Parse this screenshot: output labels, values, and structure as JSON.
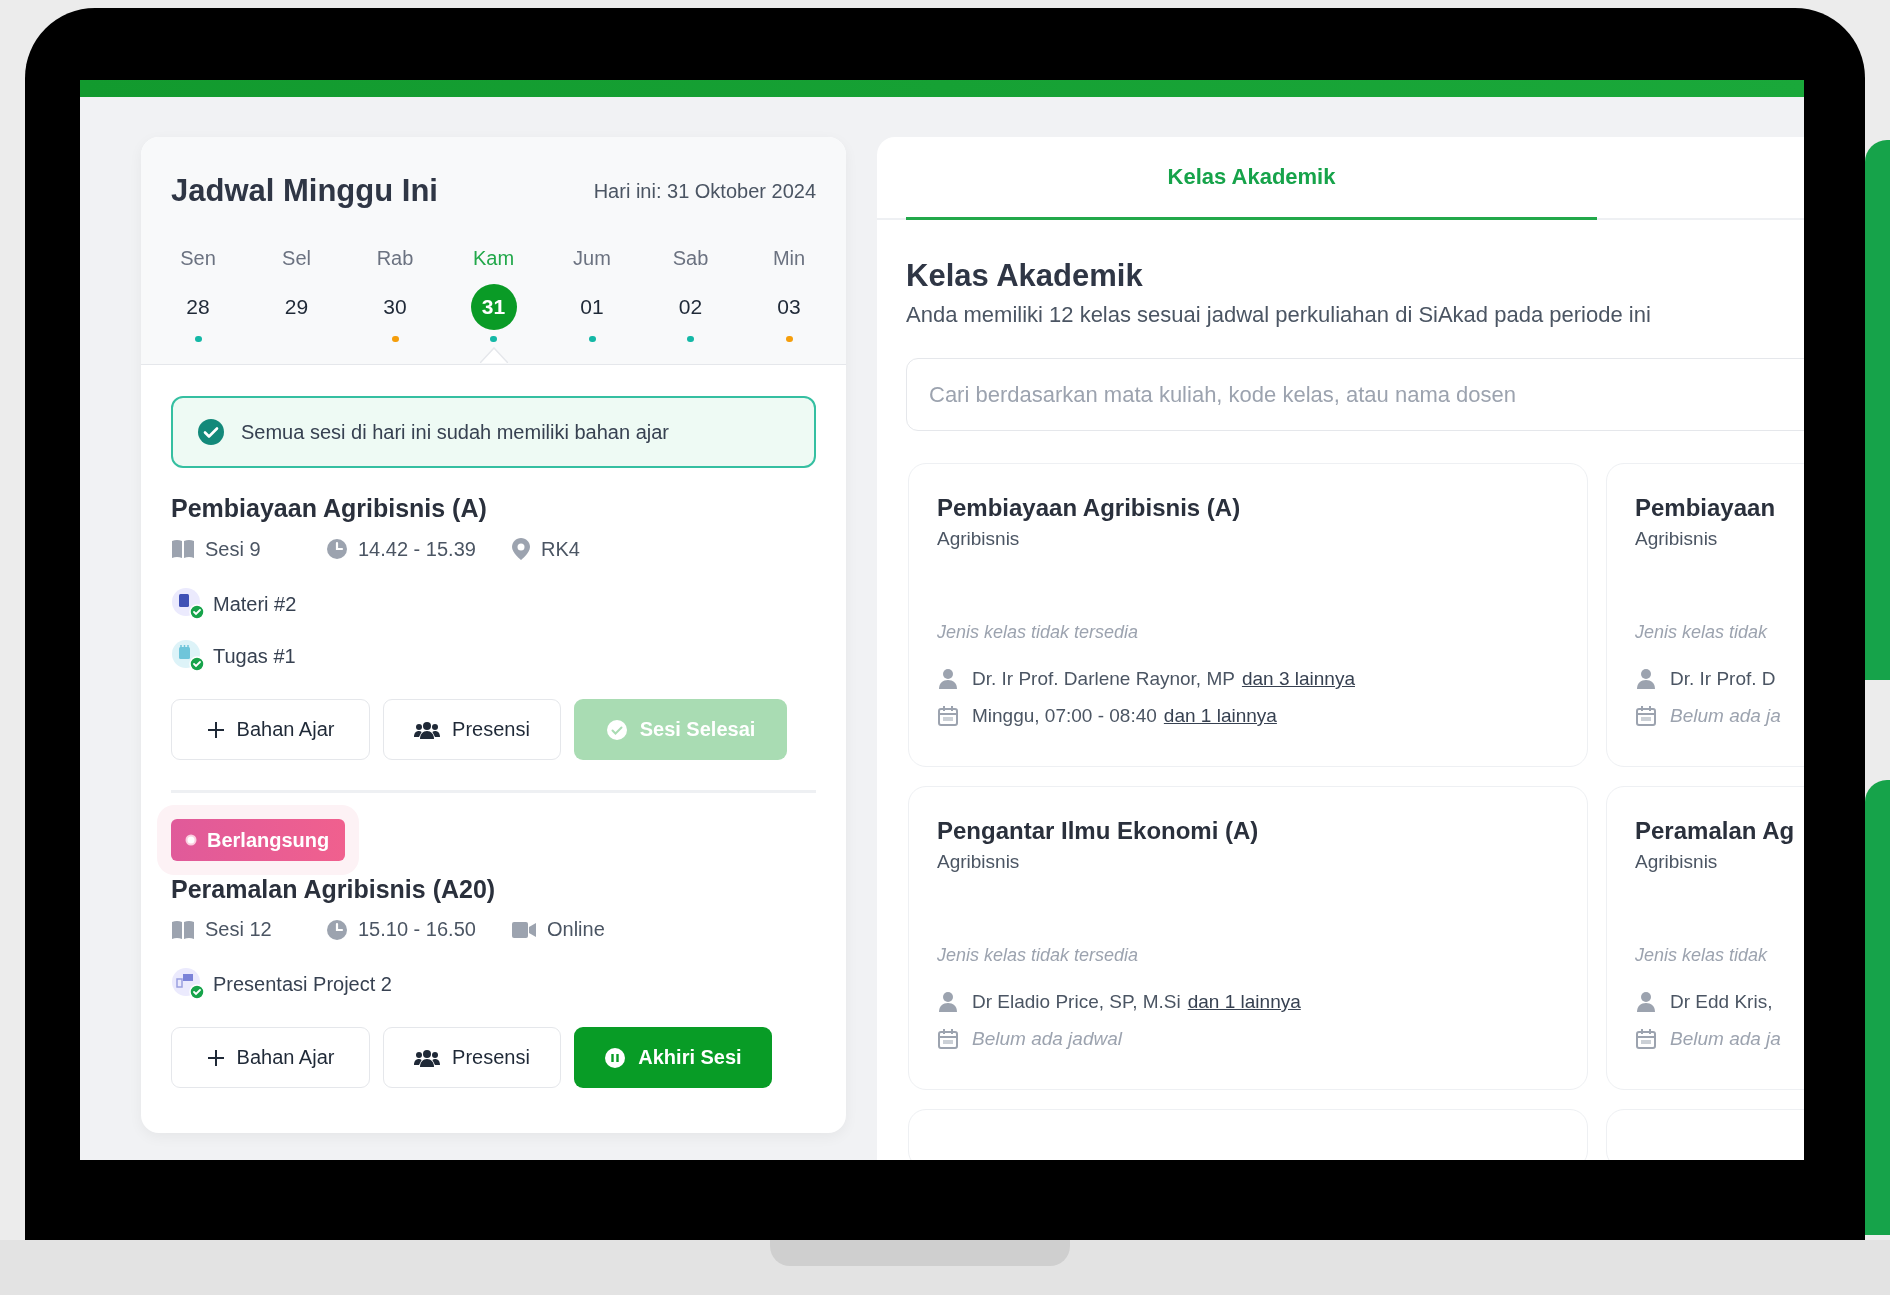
{
  "schedule": {
    "title": "Jadwal Minggu Ini",
    "today_label": "Hari ini: 31 Oktober 2024",
    "days": [
      {
        "day": "Sen",
        "date": "28",
        "selected": false,
        "color": "#14b8a6"
      },
      {
        "day": "Sel",
        "date": "29",
        "selected": false
      },
      {
        "day": "Rab",
        "date": "30",
        "selected": false,
        "color": "#f59e0b"
      },
      {
        "day": "Kam",
        "date": "31",
        "selected": true,
        "color": "#14b8a6"
      },
      {
        "day": "Jum",
        "date": "01",
        "selected": false,
        "color": "#14b8a6"
      },
      {
        "day": "Sab",
        "date": "02",
        "selected": false,
        "color": "#14b8a6"
      },
      {
        "day": "Min",
        "date": "03",
        "selected": false,
        "color": "#f59e0b"
      }
    ],
    "notice": "Semua sesi di hari ini sudah memiliki bahan ajar",
    "sessions": [
      {
        "title": "Pembiayaan Agribisnis (A)",
        "session": "Sesi 9",
        "time": "14.42 - 15.39",
        "location": "RK4",
        "kind": "room",
        "materials": [
          {
            "label": "Materi #2",
            "kind": "material",
            "done": true
          },
          {
            "label": "Tugas #1",
            "kind": "assignment",
            "done": true
          }
        ],
        "buttons": [
          {
            "label": "Bahan Ajar",
            "kind": "add",
            "disabled": false
          },
          {
            "label": "Presensi",
            "kind": "attendance",
            "disabled": false
          },
          {
            "label": "Sesi Selesai",
            "kind": "done",
            "disabled": true
          }
        ]
      },
      {
        "badge": "Berlangsung",
        "title": "Peramalan Agribisnis (A20)",
        "session": "Sesi 12",
        "time": "15.10 - 16.50",
        "location": "Online",
        "kind": "online",
        "materials": [
          {
            "label": "Presentasi Project 2",
            "kind": "presentation",
            "done": true
          }
        ],
        "buttons": [
          {
            "label": "Bahan Ajar",
            "kind": "add",
            "disabled": false
          },
          {
            "label": "Presensi",
            "kind": "attendance",
            "disabled": false
          },
          {
            "label": "Akhiri Sesi",
            "kind": "end",
            "disabled": false
          }
        ]
      }
    ]
  },
  "tabs": [
    {
      "label": "Kelas Akademik",
      "selected": true
    }
  ],
  "classes": {
    "title": "Kelas Akademik",
    "subtitle": "Anda memiliki 12 kelas sesuai jadwal perkuliahan di SiAkad pada periode ini",
    "search": {
      "placeholder": "Cari berdasarkan mata kuliah, kode kelas, atau nama dosen"
    },
    "cards": [
      {
        "title": "Pembiayaan Agribisnis (A)",
        "program": "Agribisnis",
        "class_type": "Jenis kelas tidak tersedia",
        "lecturer": "Dr. Ir Prof. Darlene Raynor, MP",
        "lecturer_more": "dan 3 lainnya",
        "schedule": "Minggu, 07:00 - 08:40",
        "schedule_more": "dan 1 lainnya",
        "schedule_available": true
      },
      {
        "title": "Pembiayaan",
        "program": "Agribisnis",
        "class_type": "Jenis kelas tidak",
        "lecturer": "Dr. Ir Prof. D",
        "schedule": "Belum ada ja",
        "schedule_available": false
      },
      {
        "title": "Pengantar Ilmu Ekonomi (A)",
        "program": "Agribisnis",
        "class_type": "Jenis kelas tidak tersedia",
        "lecturer": "Dr Eladio Price, SP, M.Si",
        "lecturer_more": "dan 1 lainnya",
        "schedule": "Belum ada jadwal",
        "schedule_available": false
      },
      {
        "title": "Peramalan Ag",
        "program": "Agribisnis",
        "class_type": "Jenis kelas tidak",
        "lecturer": "Dr Edd Kris,",
        "schedule": "Belum ada ja",
        "schedule_available": false
      }
    ]
  }
}
